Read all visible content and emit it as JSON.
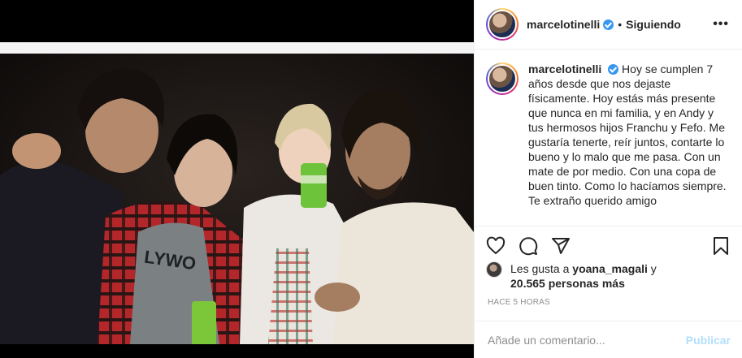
{
  "post": {
    "username": "marcelotinelli",
    "separator": "•",
    "follow_status": "Siguiendo",
    "more_icon": "•••",
    "caption": {
      "username": "marcelotinelli",
      "text": "Hoy se cumplen 7 años desde que nos dejaste físicamente. Hoy estás más presente que nunca en mi familia, y en Andy y tus hermosos hijos Franchu y Fefo. Me gustaría tenerte, reír juntos, contarte lo bueno y lo malo que me pasa. Con un mate de por medio. Con una copa de buen tinto. Como lo hacíamos siempre. Te extraño querido amigo"
    },
    "likes": {
      "prefix": "Les gusta a",
      "liker": "yoana_magali",
      "conj": "y",
      "count": "20.565 personas más"
    },
    "timestamp": "HACE 5 HORAS",
    "comment": {
      "placeholder": "Añade un comentario...",
      "publish_label": "Publicar"
    },
    "photo_text": "LYWO",
    "colors": {
      "verified": "#3897f0",
      "publish_disabled": "#b2dffc",
      "border": "#efefef",
      "meta": "#8e8e8e"
    },
    "icons": [
      "heart-icon",
      "comment-icon",
      "share-icon",
      "bookmark-icon",
      "verified-icon",
      "more-icon"
    ]
  }
}
